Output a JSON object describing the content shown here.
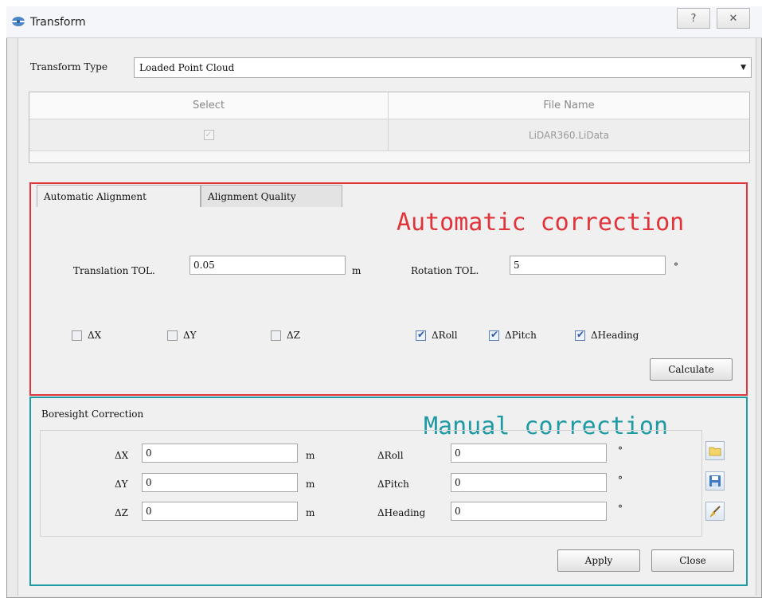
{
  "window": {
    "title": "Transform",
    "help_label": "?",
    "close_label": "✕"
  },
  "transform_type": {
    "label": "Transform Type",
    "value": "Loaded Point Cloud"
  },
  "file_table": {
    "headers": [
      "Select",
      "File Name"
    ],
    "rows": [
      {
        "selected": true,
        "file_name": "LiDAR360.LiData"
      }
    ]
  },
  "tabs": [
    {
      "label": "Automatic Alignment",
      "active": true
    },
    {
      "label": "Alignment Quality",
      "active": false
    }
  ],
  "annotations": {
    "automatic": "Automatic correction",
    "manual": "Manual correction"
  },
  "auto_alignment": {
    "translation": {
      "label": "Translation TOL.",
      "value": "0.05",
      "unit": "m"
    },
    "rotation": {
      "label": "Rotation TOL.",
      "value": "5",
      "unit": "°"
    },
    "checks": [
      {
        "label": "ΔX",
        "checked": false
      },
      {
        "label": "ΔY",
        "checked": false
      },
      {
        "label": "ΔZ",
        "checked": false
      },
      {
        "label": "ΔRoll",
        "checked": true
      },
      {
        "label": "ΔPitch",
        "checked": true
      },
      {
        "label": "ΔHeading",
        "checked": true
      }
    ],
    "calculate_label": "Calculate"
  },
  "boresight": {
    "title": "Boresight Correction",
    "fields": [
      {
        "label": "ΔX",
        "value": "0",
        "unit": "m"
      },
      {
        "label": "ΔY",
        "value": "0",
        "unit": "m"
      },
      {
        "label": "ΔZ",
        "value": "0",
        "unit": "m"
      },
      {
        "label": "ΔRoll",
        "value": "0",
        "unit": "°"
      },
      {
        "label": "ΔPitch",
        "value": "0",
        "unit": "°"
      },
      {
        "label": "ΔHeading",
        "value": "0",
        "unit": "°"
      }
    ],
    "icons": [
      "folder-icon",
      "save-icon",
      "clear-icon"
    ]
  },
  "buttons": {
    "apply": "Apply",
    "close": "Close"
  },
  "colors": {
    "auto_box": "#e0343a",
    "manual_box": "#1d9aa4"
  }
}
